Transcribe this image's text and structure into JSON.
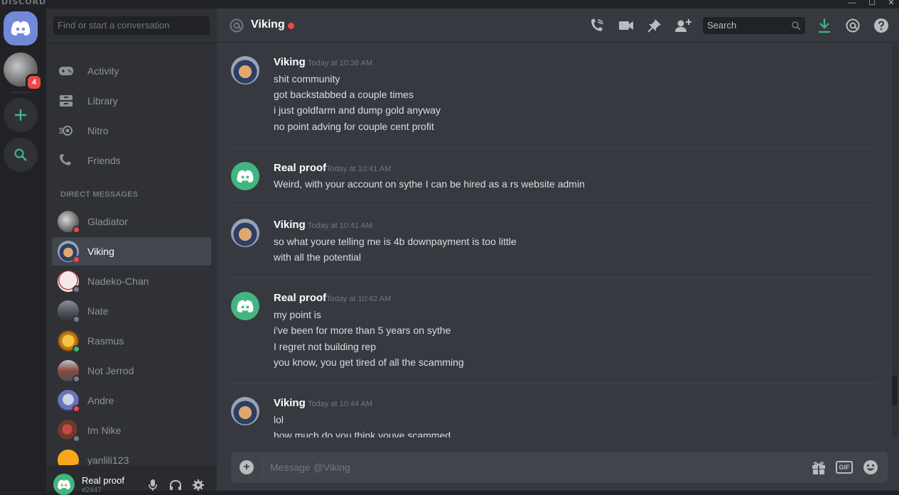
{
  "app": {
    "brand": "DISCORD"
  },
  "window": {
    "minimize": "—",
    "maximize": "☐",
    "close": "✕"
  },
  "rail": {
    "notification_count": "4"
  },
  "sidebar": {
    "search_placeholder": "Find or start a conversation",
    "nav": [
      {
        "label": "Activity",
        "icon": "gamepad-icon"
      },
      {
        "label": "Library",
        "icon": "library-icon"
      },
      {
        "label": "Nitro",
        "icon": "nitro-icon"
      },
      {
        "label": "Friends",
        "icon": "friends-icon"
      }
    ],
    "dm_header": "DIRECT MESSAGES",
    "dms": [
      {
        "name": "Gladiator",
        "status": "dnd"
      },
      {
        "name": "Viking",
        "status": "dnd",
        "active": true
      },
      {
        "name": "Nadeko-Chan",
        "status": "off"
      },
      {
        "name": "Nate",
        "status": "off"
      },
      {
        "name": "Rasmus",
        "status": "on"
      },
      {
        "name": "Not Jerrod",
        "status": "off"
      },
      {
        "name": "Andre",
        "status": "dnd"
      },
      {
        "name": "Im Nike",
        "status": "off"
      },
      {
        "name": "yanlili123",
        "status": "on"
      }
    ]
  },
  "user": {
    "name": "Real proof",
    "tag": "#2447"
  },
  "chat": {
    "channel": "Viking",
    "search_placeholder": "Search",
    "composer_placeholder": "Message @Viking",
    "groups": [
      {
        "author": "Viking",
        "timestamp": "Today at 10:38 AM",
        "avatar": "viking",
        "lines": [
          "shit community",
          "got backstabbed a couple times",
          "i just goldfarm and dump gold anyway",
          "no point adving for couple cent profit"
        ]
      },
      {
        "author": "Real proof",
        "timestamp": "Today at 10:41 AM",
        "avatar": "discord",
        "lines": [
          "Weird, with your account on sythe I can be hired as a rs website admin"
        ]
      },
      {
        "author": "Viking",
        "timestamp": "Today at 10:41 AM",
        "avatar": "viking",
        "lines": [
          "so what youre telling me is 4b downpayment is too little",
          "with all the potential"
        ]
      },
      {
        "author": "Real proof",
        "timestamp": "Today at 10:42 AM",
        "avatar": "discord",
        "lines": [
          "my point is",
          "i've been for more than 5 years on sythe",
          "I regret not building rep",
          "you know, you get tired of all the scamming"
        ]
      },
      {
        "author": "Viking",
        "timestamp": "Today at 10:44 AM",
        "avatar": "viking",
        "lines": [
          "lol",
          "how much do you think youve scammed"
        ]
      }
    ]
  },
  "colors": {
    "blurple": "#7289da",
    "online": "#43b581",
    "dnd": "#f04747",
    "offline": "#747f8d"
  }
}
